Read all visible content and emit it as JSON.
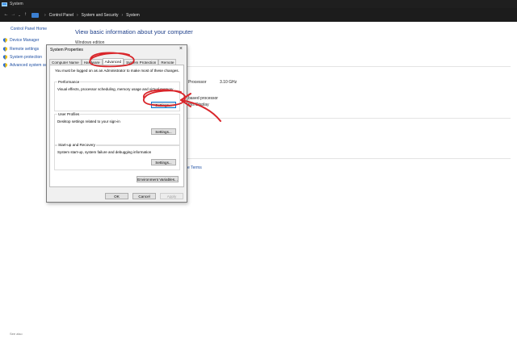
{
  "window": {
    "title": "System"
  },
  "addressbar": {
    "crumbs": [
      "Control Panel",
      "System and Security",
      "System"
    ]
  },
  "left_pane": {
    "home_link": "Control Panel Home",
    "links": [
      "Device Manager",
      "Remote settings",
      "System protection",
      "Advanced system se"
    ],
    "see_also": "See also"
  },
  "main": {
    "heading": "View basic information about your computer",
    "edition_heading": "Windows edition",
    "processor_label": "Processor",
    "processor_speed": "3.10 GHz",
    "system_type_value": "based processor",
    "pen_touch_value": "this Display",
    "license_terms_fragment": "e Terms"
  },
  "dialog": {
    "title": "System Properties",
    "close_glyph": "×",
    "tabs": [
      "Computer Name",
      "Hardware",
      "Advanced",
      "System Protection",
      "Remote"
    ],
    "active_tab": "Advanced",
    "admin_note": "You must be logged on as an Administrator to make most of these changes.",
    "performance": {
      "title": "Performance",
      "description": "Visual effects, processor scheduling, memory usage and virtual memory",
      "button": "Settings..."
    },
    "user_profiles": {
      "title": "User Profiles",
      "description": "Desktop settings related to your sign-in",
      "button": "Settings..."
    },
    "startup_recovery": {
      "title": "Start-up and Recovery",
      "description": "System start-up, system failure and debugging information",
      "button": "Settings..."
    },
    "env_button": "Environment Variables...",
    "ok": "OK",
    "cancel": "Cancel",
    "apply": "Apply"
  },
  "colors": {
    "annotation_red": "#d9252a",
    "link_blue": "#1e4fa3",
    "heading_blue": "#1e3f8a",
    "titlebar": "#1f1f1f"
  }
}
